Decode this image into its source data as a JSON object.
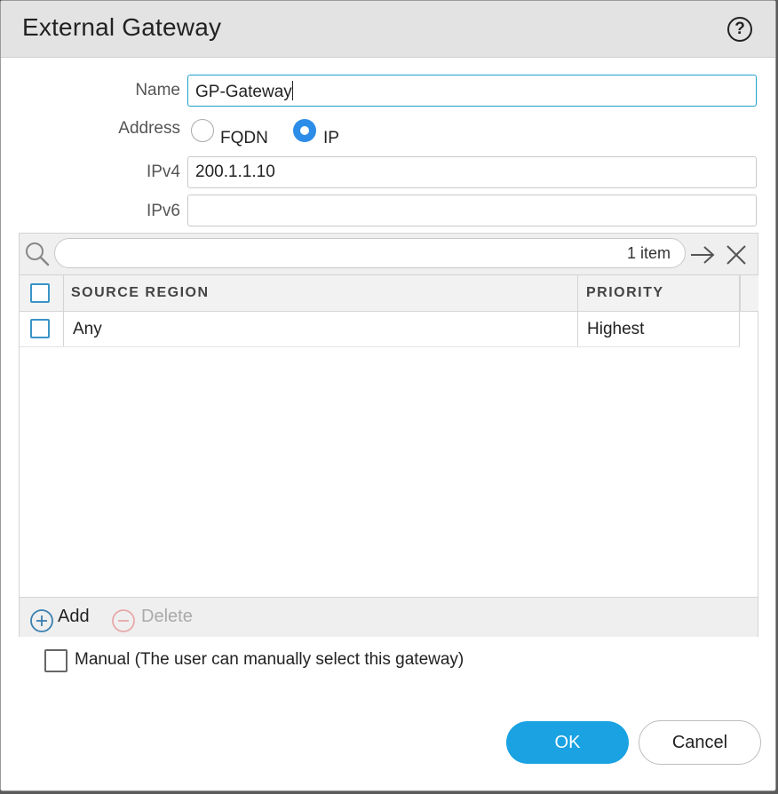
{
  "dialog": {
    "title": "External Gateway",
    "help_glyph": "?"
  },
  "form": {
    "name_label": "Name",
    "name_value": "GP-Gateway",
    "address_label": "Address",
    "address_options": [
      {
        "label": "FQDN",
        "checked": false
      },
      {
        "label": "IP",
        "checked": true
      }
    ],
    "ipv4_label": "IPv4",
    "ipv4_value": "200.1.1.10",
    "ipv6_label": "IPv6",
    "ipv6_value": ""
  },
  "grid": {
    "search_placeholder": "",
    "item_count": "1 item",
    "columns": [
      "SOURCE REGION",
      "PRIORITY"
    ],
    "rows": [
      {
        "source_region": "Any",
        "priority": "Highest",
        "checked": false
      }
    ],
    "add_label": "Add",
    "delete_label": "Delete"
  },
  "manual": {
    "label": "Manual (The user can manually select this gateway)",
    "checked": false
  },
  "actions": {
    "ok_label": "OK",
    "cancel_label": "Cancel"
  },
  "colors": {
    "accent": "#1aa2e2",
    "radio_selected": "#2c8de8",
    "checkbox_border": "#3a94c8",
    "delete_disabled": "#e8a8a8"
  },
  "icons": {
    "help": "help-icon",
    "search": "search-icon",
    "go": "arrow-right-icon",
    "clear": "close-icon",
    "add": "plus-circle-icon",
    "delete": "minus-circle-icon"
  }
}
